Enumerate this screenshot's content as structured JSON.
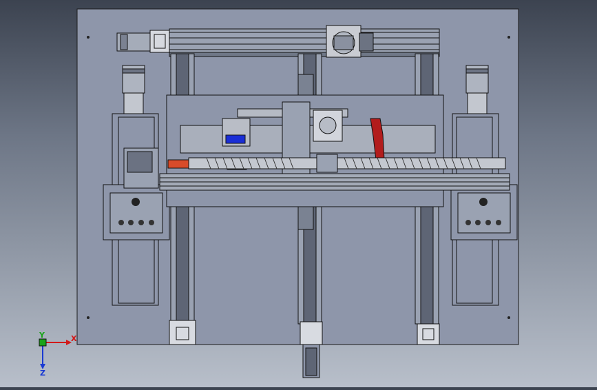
{
  "viewport": {
    "background_top": "#3c4350",
    "background_bottom": "#b8bfca",
    "plate_color": "#8e96aa",
    "outline_color": "#1a1a1a"
  },
  "triad": {
    "x_label": "X",
    "y_label": "Y",
    "z_label": "Z",
    "x_color": "#d21a1a",
    "y_color": "#1aa31a",
    "z_color": "#1a3ad2"
  },
  "highlights": {
    "blue_block_color": "#1a2ed6",
    "red_part_color": "#b21c1c",
    "rail_color": "#9aa2b2"
  }
}
